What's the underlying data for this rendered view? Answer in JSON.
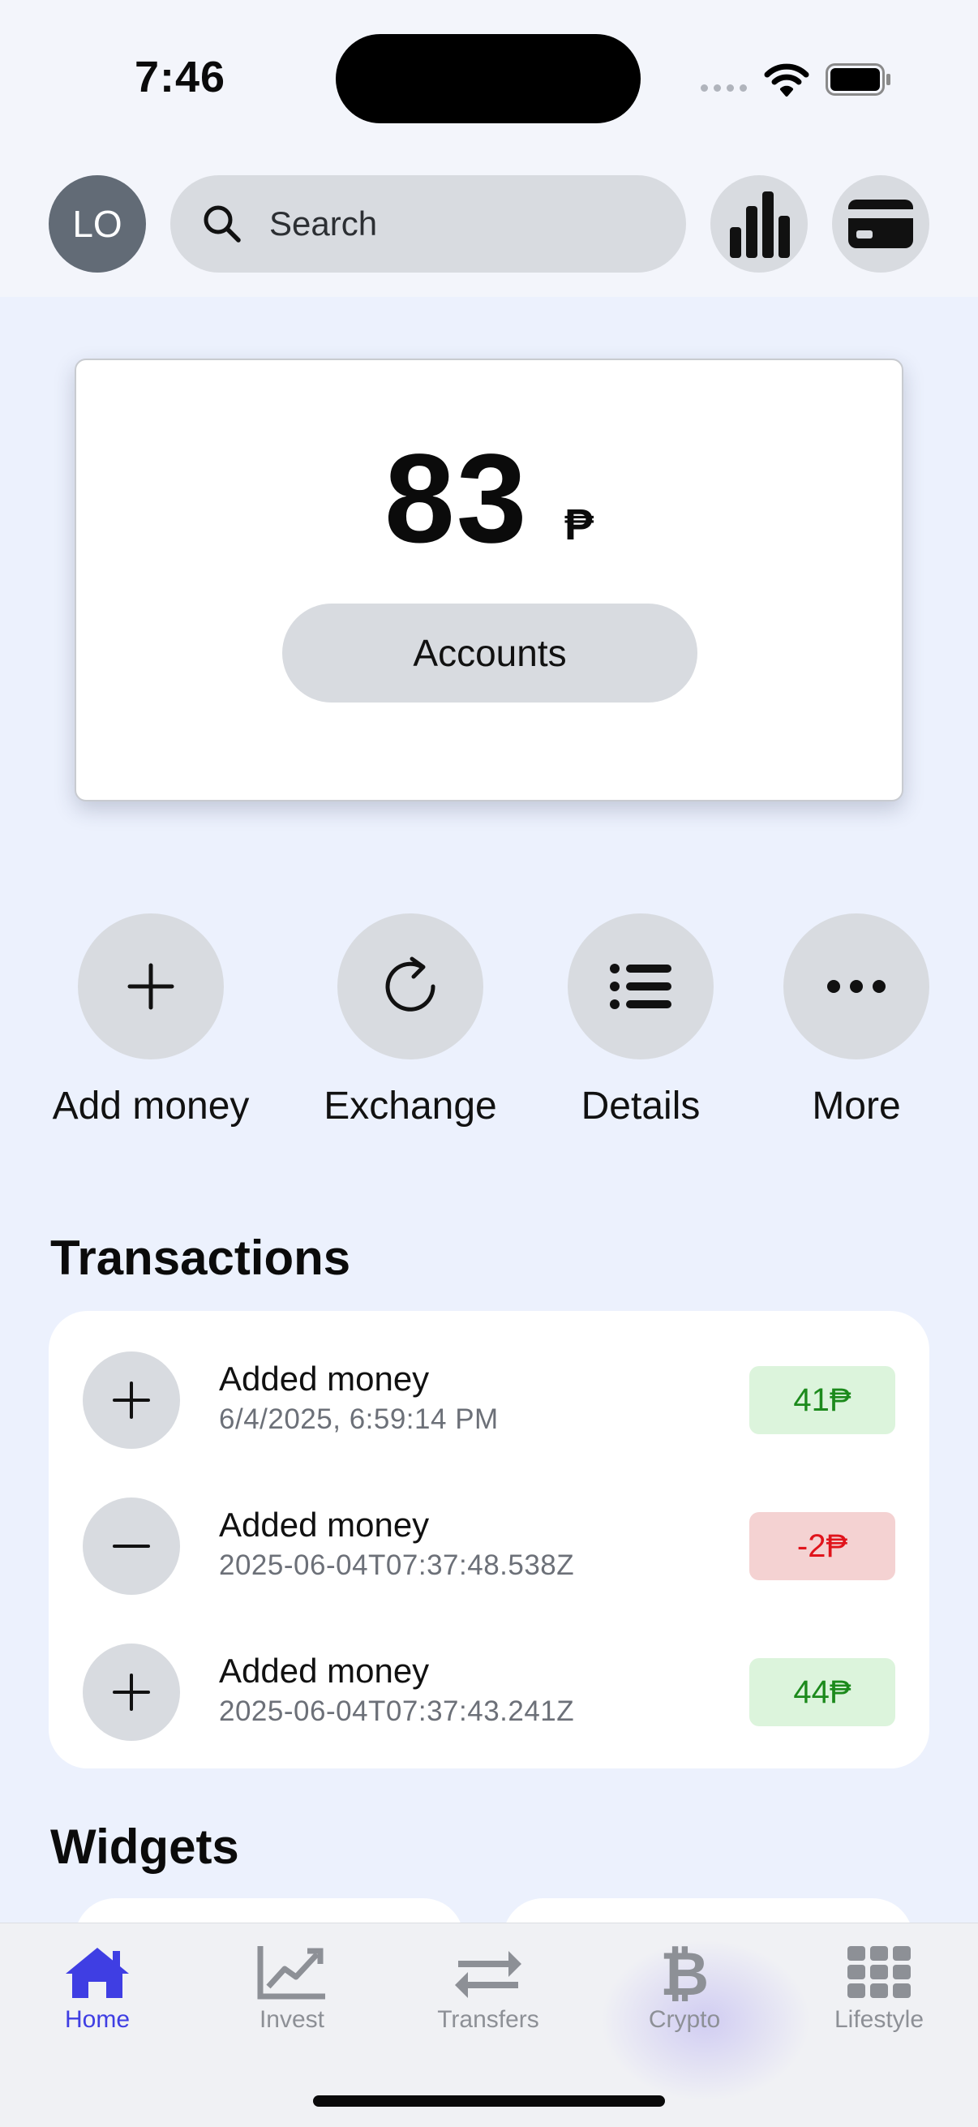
{
  "status_bar": {
    "time": "7:46"
  },
  "header": {
    "avatar_initials": "LO",
    "search_placeholder": "Search"
  },
  "balance": {
    "amount": "83",
    "currency": "₱",
    "accounts_label": "Accounts"
  },
  "actions": [
    {
      "label": "Add money",
      "icon": "plus-icon"
    },
    {
      "label": "Exchange",
      "icon": "refresh-icon"
    },
    {
      "label": "Details",
      "icon": "list-icon"
    },
    {
      "label": "More",
      "icon": "more-icon"
    }
  ],
  "transactions": {
    "title": "Transactions",
    "items": [
      {
        "title": "Added money",
        "date": "6/4/2025, 6:59:14 PM",
        "amount": "41₱",
        "type": "positive",
        "icon": "plus-icon"
      },
      {
        "title": "Added money",
        "date": "2025-06-04T07:37:48.538Z",
        "amount": "-2₱",
        "type": "negative",
        "icon": "minus-icon"
      },
      {
        "title": "Added money",
        "date": "2025-06-04T07:37:43.241Z",
        "amount": "44₱",
        "type": "positive",
        "icon": "plus-icon"
      }
    ]
  },
  "widgets": {
    "title": "Widgets"
  },
  "tab_bar": {
    "active_color": "#3f3ee3",
    "inactive_color": "#8d9096",
    "tabs": [
      {
        "label": "Home",
        "icon": "home-icon",
        "active": true
      },
      {
        "label": "Invest",
        "icon": "chart-line-icon",
        "active": false
      },
      {
        "label": "Transfers",
        "icon": "transfer-arrows-icon",
        "active": false
      },
      {
        "label": "Crypto",
        "icon": "bitcoin-icon",
        "active": false
      },
      {
        "label": "Lifestyle",
        "icon": "grid-icon",
        "active": false
      }
    ]
  }
}
